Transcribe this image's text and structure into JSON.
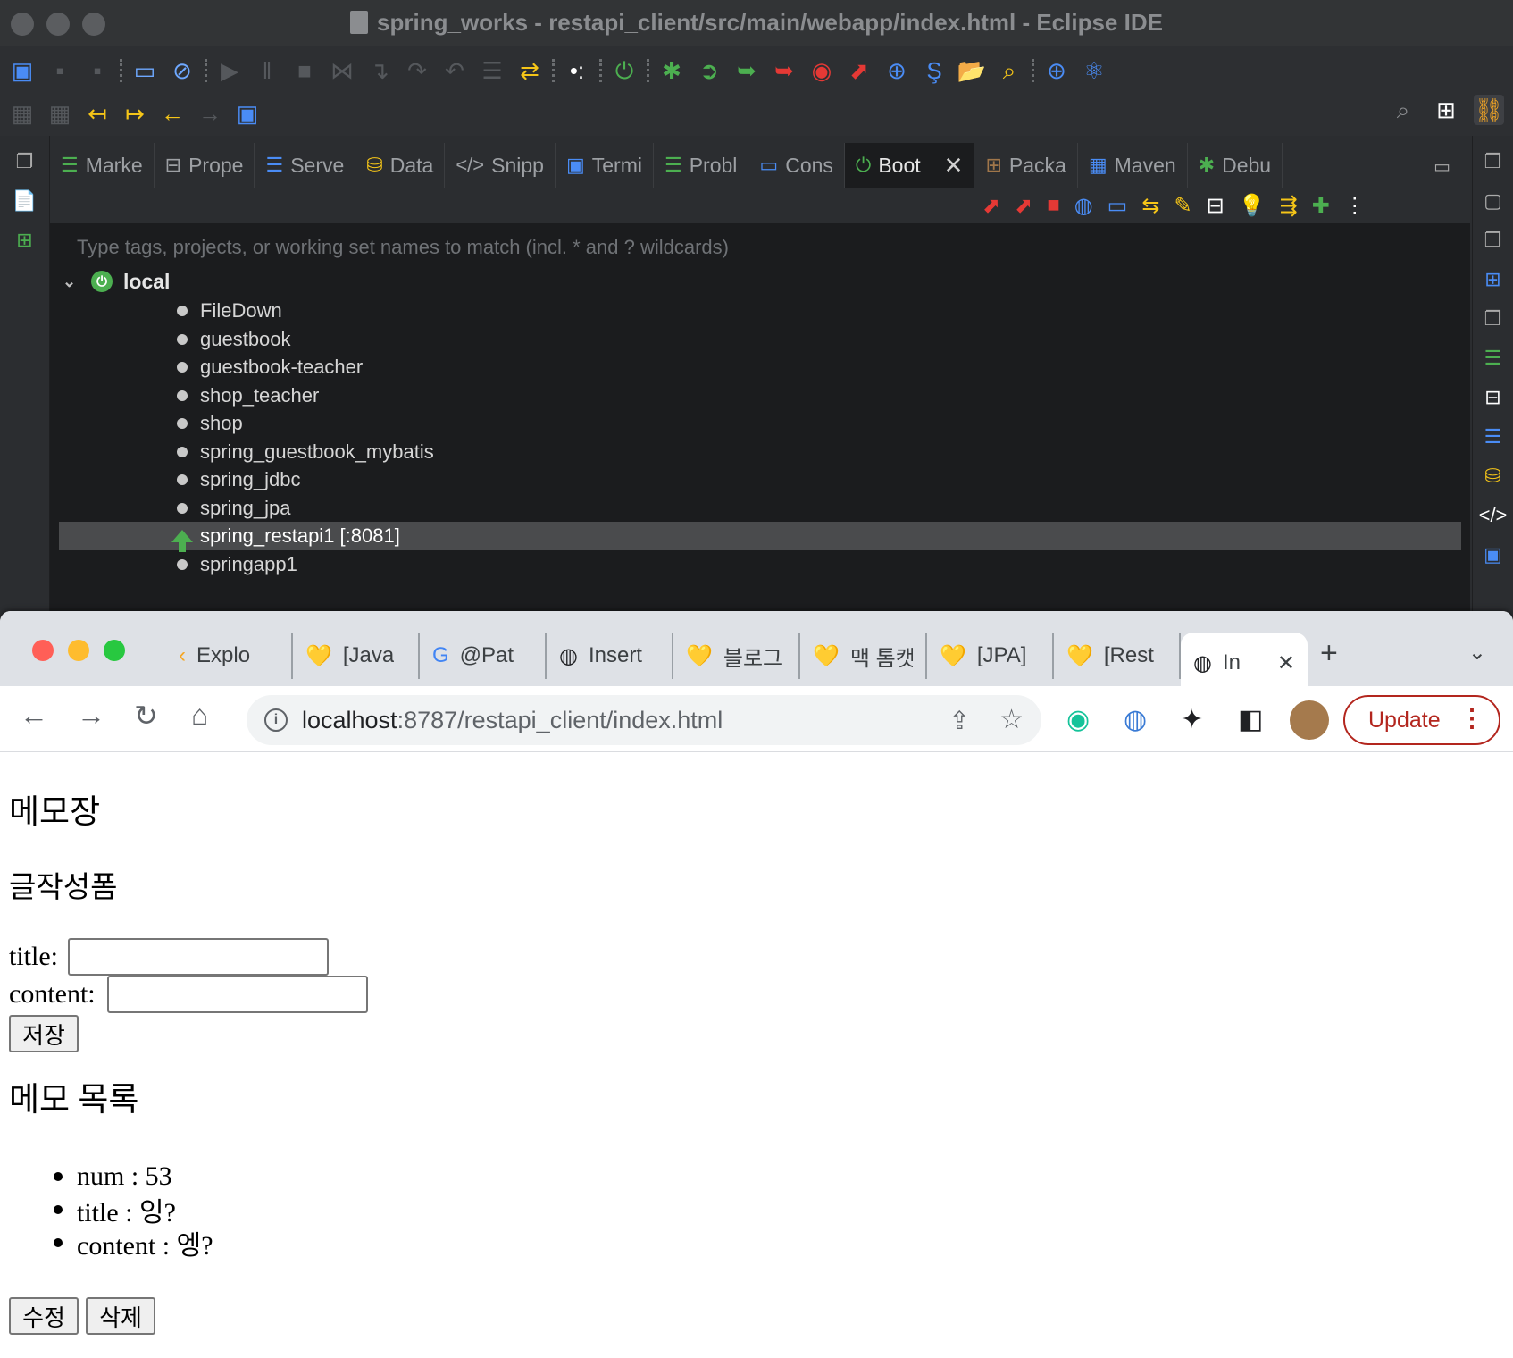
{
  "eclipse": {
    "title": "spring_works - restapi_client/src/main/webapp/index.html - Eclipse IDE",
    "tabs": [
      {
        "label": "Marke",
        "icon": "markers-icon"
      },
      {
        "label": "Prope",
        "icon": "properties-icon"
      },
      {
        "label": "Serve",
        "icon": "servers-icon"
      },
      {
        "label": "Data",
        "icon": "data-source-icon"
      },
      {
        "label": "Snipp",
        "icon": "snippets-icon"
      },
      {
        "label": "Termi",
        "icon": "terminal-icon"
      },
      {
        "label": "Probl",
        "icon": "problems-icon"
      },
      {
        "label": "Cons",
        "icon": "console-icon"
      },
      {
        "label": "Boot",
        "icon": "boot-dashboard-icon",
        "active": true
      },
      {
        "label": "Packa",
        "icon": "package-explorer-icon"
      },
      {
        "label": "Maven",
        "icon": "maven-icon"
      },
      {
        "label": "Debu",
        "icon": "debug-icon"
      }
    ],
    "filter_placeholder": "Type tags, projects, or working set names to match (incl. * and ? wildcards)",
    "tree": {
      "root": "local",
      "items": [
        "FileDown",
        "guestbook",
        "guestbook-teacher",
        "shop_teacher",
        "shop",
        "spring_guestbook_mybatis",
        "spring_jdbc",
        "spring_jpa",
        "spring_restapi1 [:8081]",
        "springapp1"
      ],
      "running_item": "spring_restapi1 [:8081]"
    }
  },
  "chrome": {
    "tabs": [
      {
        "label": "Explo",
        "icon": "explorer-icon"
      },
      {
        "label": "[Java",
        "icon": "heart-icon"
      },
      {
        "label": "@Pat",
        "icon": "google-icon"
      },
      {
        "label": "Insert",
        "icon": "globe-icon"
      },
      {
        "label": "블로그",
        "icon": "heart-icon"
      },
      {
        "label": "맥 톰캣",
        "icon": "heart-icon"
      },
      {
        "label": "[JPA]",
        "icon": "heart-icon"
      },
      {
        "label": "[Rest",
        "icon": "heart-icon"
      },
      {
        "label": "In",
        "icon": "globe-icon",
        "active": true
      }
    ],
    "url_host": "localhost",
    "url_rest": ":8787/restapi_client/index.html",
    "update_label": "Update"
  },
  "page": {
    "heading": "메모장",
    "form_heading": "글작성폼",
    "title_label": "title:",
    "title_value": "",
    "content_label": "content:",
    "content_value": "",
    "save_label": "저장",
    "list_heading": "메모 목록",
    "memo": [
      "num : 53",
      "title : 잉?",
      "content : 엥?"
    ],
    "edit_label": "수정",
    "delete_label": "삭제"
  },
  "colors": {
    "eclipse_bg": "#2b2d30",
    "panel_bg": "#1b1c1e",
    "boot_green": "#4caf50",
    "update_red": "#b3261e"
  }
}
